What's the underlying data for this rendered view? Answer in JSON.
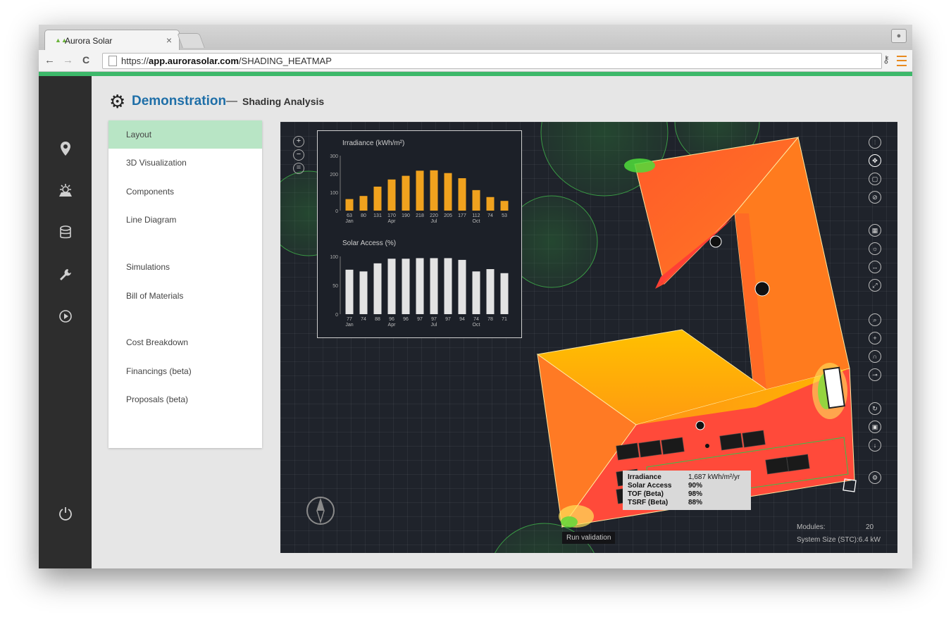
{
  "browser": {
    "tab_title": "Aurora Solar",
    "tab_close": "×",
    "url_scheme": "https://",
    "url_host": "app.aurorasolar.com",
    "url_path": "/SHADING_HEATMAP",
    "nav_back": "←",
    "nav_forward": "→",
    "nav_reload": "C"
  },
  "sidebar": {
    "icons": [
      "location-pin-icon",
      "sun-panel-icon",
      "database-icon",
      "wrench-icon",
      "play-icon",
      "power-icon"
    ]
  },
  "header": {
    "project": "Demonstration",
    "separator": "—",
    "subtitle": "Shading Analysis"
  },
  "menu": {
    "items": [
      {
        "label": "Layout",
        "active": true
      },
      {
        "label": "3D Visualization"
      },
      {
        "label": "Components"
      },
      {
        "label": "Line Diagram"
      },
      {
        "label": "Simulations"
      },
      {
        "label": "Bill of Materials"
      },
      {
        "label": "Cost Breakdown"
      },
      {
        "label": "Financings (beta)"
      },
      {
        "label": "Proposals (beta)"
      }
    ]
  },
  "chart_data": [
    {
      "type": "bar",
      "title": "Irradiance (kWh/m²)",
      "categories": [
        "Jan",
        "Feb",
        "Mar",
        "Apr",
        "May",
        "Jun",
        "Jul",
        "Aug",
        "Sep",
        "Oct",
        "Nov",
        "Dec"
      ],
      "values": [
        63,
        80,
        131,
        170,
        190,
        218,
        220,
        205,
        177,
        112,
        74,
        53
      ],
      "tick_labels": [
        "Jan",
        "Apr",
        "Jul",
        "Oct"
      ],
      "ylim": [
        0,
        300
      ],
      "yticks": [
        0,
        100,
        200,
        300
      ],
      "color": "#f0a21e"
    },
    {
      "type": "bar",
      "title": "Solar Access (%)",
      "categories": [
        "Jan",
        "Feb",
        "Mar",
        "Apr",
        "May",
        "Jun",
        "Jul",
        "Aug",
        "Sep",
        "Oct",
        "Nov",
        "Dec"
      ],
      "values": [
        77,
        74,
        88,
        96,
        96,
        97,
        97,
        97,
        94,
        74,
        78,
        71
      ],
      "tick_labels": [
        "Jan",
        "Apr",
        "Jul",
        "Oct"
      ],
      "ylim": [
        0,
        100
      ],
      "yticks": [
        0,
        50,
        100
      ],
      "color": "#e3e3e3"
    }
  ],
  "tooltip": {
    "rows": [
      {
        "label": "Irradiance",
        "value": "1,687 kWh/m²/yr"
      },
      {
        "label": "Solar Access",
        "value": "90%"
      },
      {
        "label": "TOF (Beta)",
        "value": "98%"
      },
      {
        "label": "TSRF (Beta)",
        "value": "88%"
      }
    ]
  },
  "viewport": {
    "run_validation": "Run validation",
    "modules_label": "Modules:",
    "modules_value": "20",
    "system_size_label": "System Size (STC):",
    "system_size_value": "6.4 kW",
    "zoom_controls": [
      "+",
      "−",
      "="
    ]
  },
  "colors": {
    "accent_green": "#3db86a",
    "project_blue": "#1f6fa8",
    "roof_hot": "#ff6a2a",
    "roof_warm": "#ffb000"
  }
}
